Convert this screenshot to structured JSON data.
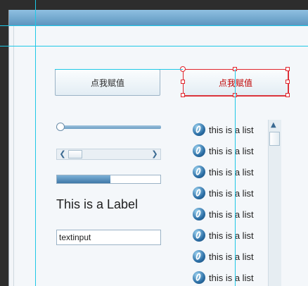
{
  "buttons": {
    "primary_label": "点我赋值",
    "secondary_label": "点我赋值"
  },
  "slider": {
    "value": 0.0
  },
  "hscroll": {
    "position": 0.0
  },
  "progress": {
    "value": 0.52
  },
  "label": {
    "text": "This is a Label"
  },
  "textinput": {
    "value": "textinput"
  },
  "list": {
    "items": [
      "this is a list",
      "this is a list",
      "this is a list",
      "this is a list",
      "this is a list",
      "this is a list",
      "this is a list",
      "this is a list"
    ]
  },
  "icons": {
    "list_item": "o-orb-icon",
    "scroll_left": "chevron-left-icon",
    "scroll_right": "chevron-right-icon",
    "scroll_up": "chevron-up-icon"
  },
  "colors": {
    "accent": "#5d95bf",
    "selection": "#e0242c",
    "guide": "#1ec8e6"
  }
}
